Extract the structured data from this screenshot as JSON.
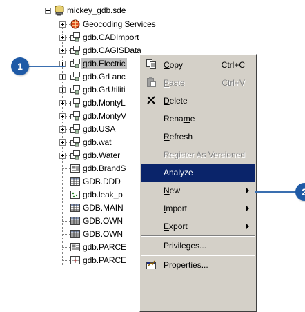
{
  "tree": {
    "root": {
      "label": "mickey_gdb.sde",
      "icon": "database-server-icon"
    },
    "children": [
      {
        "label": "Geocoding Services",
        "icon": "geocoding-services-icon",
        "expandable": true
      },
      {
        "label": "gdb.CADImport",
        "icon": "feature-dataset-icon",
        "expandable": true
      },
      {
        "label": "gdb.CAGISData",
        "icon": "feature-dataset-icon",
        "expandable": true
      },
      {
        "label": "gdb.Electric",
        "icon": "feature-dataset-icon",
        "expandable": true,
        "selected": true
      },
      {
        "label": "gdb.GrLanc",
        "icon": "feature-dataset-icon",
        "expandable": true
      },
      {
        "label": "gdb.GrUtiliti",
        "icon": "feature-dataset-icon",
        "expandable": true
      },
      {
        "label": "gdb.MontyL",
        "icon": "feature-dataset-icon",
        "expandable": true
      },
      {
        "label": "gdb.MontyV",
        "icon": "feature-dataset-icon",
        "expandable": true
      },
      {
        "label": "gdb.USA",
        "icon": "feature-dataset-icon",
        "expandable": true
      },
      {
        "label": "gdb.wat",
        "icon": "feature-dataset-icon",
        "expandable": true
      },
      {
        "label": "gdb.Water",
        "icon": "feature-dataset-icon",
        "expandable": true
      },
      {
        "label": "gdb.BrandS",
        "icon": "raster-catalog-icon",
        "expandable": false
      },
      {
        "label": "GDB.DDD",
        "icon": "table-icon",
        "expandable": false
      },
      {
        "label": "gdb.leak_p",
        "icon": "point-feature-class-icon",
        "expandable": false
      },
      {
        "label": "GDB.MAIN",
        "icon": "table-icon",
        "expandable": false
      },
      {
        "label": "GDB.OWN",
        "icon": "table-icon",
        "expandable": false
      },
      {
        "label": "GDB.OWN",
        "icon": "table-icon",
        "expandable": false
      },
      {
        "label": "gdb.PARCE",
        "icon": "raster-catalog-icon",
        "expandable": false
      },
      {
        "label": "gdb.PARCE",
        "icon": "topology-icon",
        "expandable": false
      }
    ]
  },
  "context_menu": {
    "items": [
      {
        "pre": "",
        "u": "C",
        "post": "opy",
        "shortcut": "Ctrl+C",
        "icon": "copy-icon",
        "disabled": false
      },
      {
        "pre": "",
        "u": "P",
        "post": "aste",
        "shortcut": "Ctrl+V",
        "icon": "paste-icon",
        "disabled": true
      },
      {
        "pre": "",
        "u": "D",
        "post": "elete",
        "shortcut": "",
        "icon": "delete-icon",
        "disabled": false
      },
      {
        "pre": "Rena",
        "u": "m",
        "post": "e",
        "shortcut": "",
        "icon": "",
        "disabled": false
      },
      {
        "pre": "",
        "u": "R",
        "post": "efresh",
        "shortcut": "",
        "icon": "",
        "disabled": false
      },
      {
        "pre": "Register As Versioned",
        "u": "",
        "post": "",
        "shortcut": "",
        "icon": "",
        "disabled": true
      },
      {
        "pre": "Analyze",
        "u": "",
        "post": "",
        "shortcut": "",
        "icon": "",
        "disabled": false,
        "highlighted": true
      },
      {
        "pre": "",
        "u": "N",
        "post": "ew",
        "submenu": true
      },
      {
        "pre": "",
        "u": "I",
        "post": "mport",
        "submenu": true
      },
      {
        "pre": "",
        "u": "E",
        "post": "xport",
        "submenu": true
      },
      {
        "pre": "Privileges...",
        "u": "",
        "post": ""
      },
      {
        "pre": "",
        "u": "P",
        "post": "roperties...",
        "icon": "properties-icon"
      }
    ]
  },
  "callouts": [
    {
      "number": "1",
      "target": "gdb.Electric"
    },
    {
      "number": "2",
      "target": "Analyze"
    }
  ],
  "colors": {
    "menu_background": "#d4d0c8",
    "highlight": "#0a246a",
    "callout": "#1f5aa6",
    "selection": "#c0c0c0"
  }
}
